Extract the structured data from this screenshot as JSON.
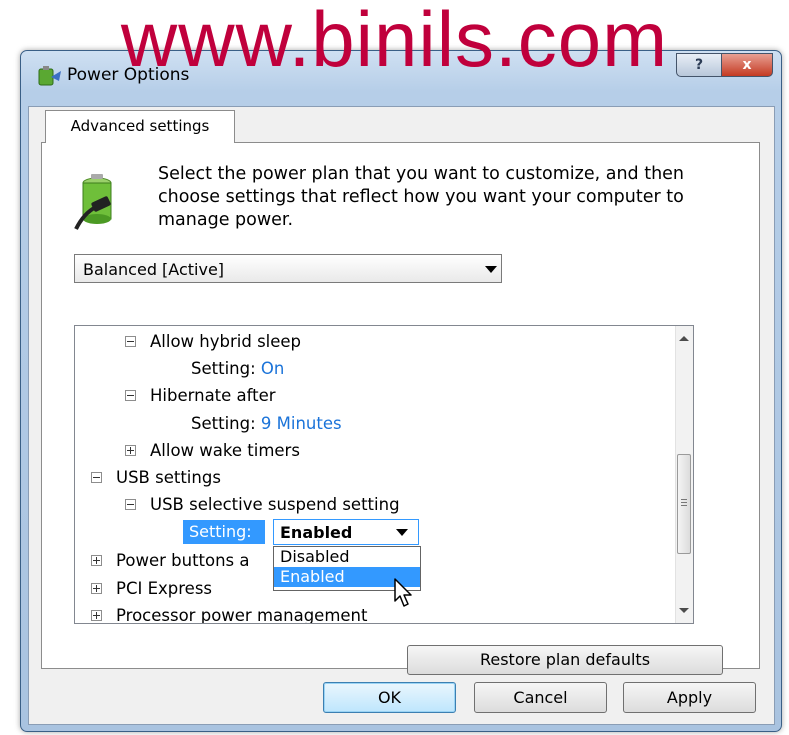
{
  "watermark": "www.binils.com",
  "window": {
    "title": "Power Options",
    "help_glyph": "?",
    "close_glyph": "x"
  },
  "tab": {
    "label": "Advanced settings"
  },
  "description": "Select the power plan that you want to customize, and then choose settings that reflect how you want your computer to manage power.",
  "plan_select": {
    "value": "Balanced [Active]"
  },
  "tree": {
    "allow_hybrid_sleep": "Allow hybrid sleep",
    "setting_label": "Setting:",
    "hybrid_sleep_value": "On",
    "hibernate_after": "Hibernate after",
    "hibernate_value": "9 Minutes",
    "allow_wake_timers": "Allow wake timers",
    "usb_settings": "USB settings",
    "usb_selective_suspend": "USB selective suspend setting",
    "usb_setting_value": "Enabled",
    "power_buttons": "Power buttons a",
    "pci_express": "PCI Express",
    "processor_power": "Processor power management"
  },
  "dropdown": {
    "options": [
      "Disabled",
      "Enabled"
    ],
    "highlighted": "Enabled"
  },
  "buttons": {
    "restore": "Restore plan defaults",
    "ok": "OK",
    "cancel": "Cancel",
    "apply": "Apply"
  },
  "colors": {
    "watermark": "#c0003c",
    "setting_value": "#1a73d9",
    "selection": "#3399ff"
  },
  "icons": {
    "app": "power-options-icon",
    "plan": "battery-plug-icon"
  }
}
